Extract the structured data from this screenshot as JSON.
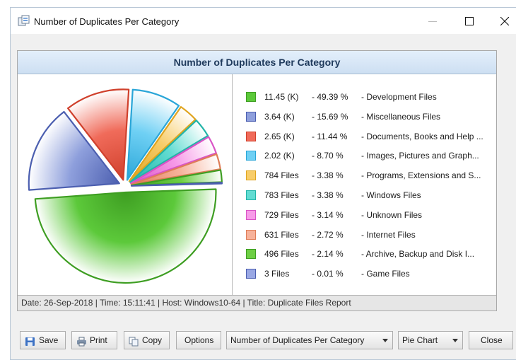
{
  "window": {
    "title": "Number of Duplicates Per Category"
  },
  "report": {
    "header": "Number of Duplicates Per Category",
    "footer": "Date: 26-Sep-2018 | Time: 15:11:41 | Host: Windows10-64 | Title: Duplicate Files Report"
  },
  "chart_data": {
    "type": "pie",
    "title": "Number of Duplicates Per Category",
    "slices": [
      {
        "value": "11.45 (K)",
        "percent": 49.39,
        "percent_label": "- 49.39 %",
        "label": "- Development Files",
        "color": "#5cc93a",
        "border": "#3e9e22"
      },
      {
        "value": "3.64 (K)",
        "percent": 15.69,
        "percent_label": "- 15.69 %",
        "label": "- Miscellaneous Files",
        "color": "#8e9fdc",
        "border": "#4c5fb0"
      },
      {
        "value": "2.65 (K)",
        "percent": 11.44,
        "percent_label": "- 11.44 %",
        "label": "- Documents, Books and Help ...",
        "color": "#f06b5a",
        "border": "#d0402c"
      },
      {
        "value": "2.02 (K)",
        "percent": 8.7,
        "percent_label": "- 8.70 %",
        "label": "- Images, Pictures and Graph...",
        "color": "#6fd0f4",
        "border": "#2aa6d8"
      },
      {
        "value": "784 Files",
        "percent": 3.38,
        "percent_label": "- 3.38 %",
        "label": "- Programs, Extensions and S...",
        "color": "#f8cd6a",
        "border": "#e0a520"
      },
      {
        "value": "783 Files",
        "percent": 3.38,
        "percent_label": "- 3.38 %",
        "label": "- Windows Files",
        "color": "#62dcd2",
        "border": "#22b4a8"
      },
      {
        "value": "729 Files",
        "percent": 3.14,
        "percent_label": "- 3.14 %",
        "label": "- Unknown Files",
        "color": "#f79be8",
        "border": "#d954c6"
      },
      {
        "value": "631 Files",
        "percent": 2.72,
        "percent_label": "- 2.72 %",
        "label": "- Internet Files",
        "color": "#f7b29a",
        "border": "#df7d58"
      },
      {
        "value": "496 Files",
        "percent": 2.14,
        "percent_label": "- 2.14 %",
        "label": "- Archive, Backup and Disk I...",
        "color": "#6ecf45",
        "border": "#3e9e22"
      },
      {
        "value": "3 Files",
        "percent": 0.01,
        "percent_label": "- 0.01 %",
        "label": "- Game Files",
        "color": "#9aa8e4",
        "border": "#4c5fb0"
      }
    ]
  },
  "toolbar": {
    "save_label": "Save",
    "print_label": "Print",
    "copy_label": "Copy",
    "options_label": "Options",
    "report_select_value": "Number of Duplicates Per Category",
    "chart_type_value": "Pie Chart",
    "close_label": "Close"
  },
  "icons": {
    "app": "duplicate-files-icon",
    "save": "floppy-disk-icon",
    "print": "printer-icon",
    "copy": "copy-icon"
  }
}
